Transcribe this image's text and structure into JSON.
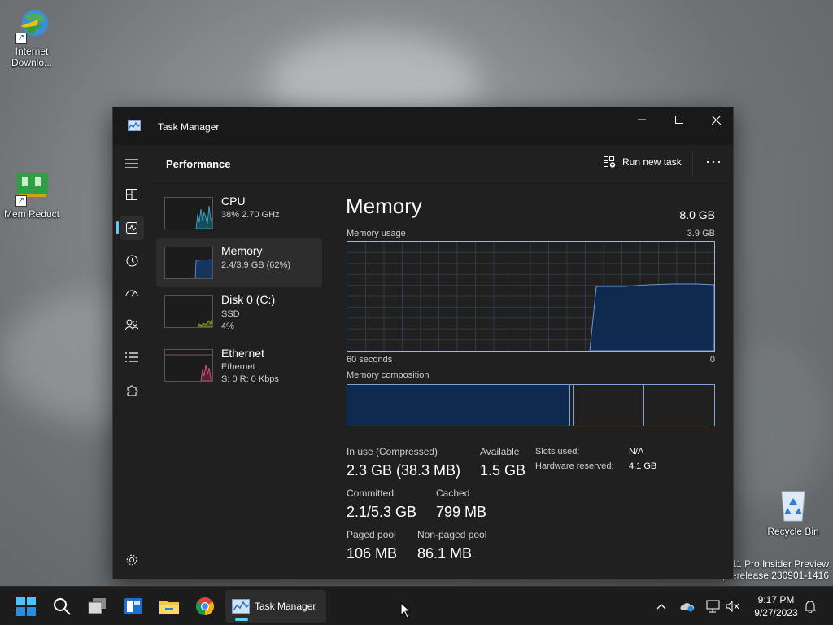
{
  "desktop": {
    "icons": [
      {
        "label_line1": "Internet",
        "label_line2": "Downlo..."
      },
      {
        "label_line1": "Mem Reduct",
        "label_line2": ""
      },
      {
        "label_line1": "Recycle Bin",
        "label_line2": ""
      }
    ],
    "watermark": {
      "line1": "11 Pro Insider Preview",
      "line2": "prerelease.230901-1416"
    }
  },
  "window": {
    "title": "Task Manager",
    "controls": {
      "minimize": "—",
      "maximize": "☐",
      "close": "✕"
    }
  },
  "toolbar": {
    "page_title": "Performance",
    "run_new_task": "Run new task",
    "more": "···"
  },
  "sidebar": {
    "items": [
      {
        "name": "CPU",
        "sub1": "38%  2.70 GHz",
        "sub2": ""
      },
      {
        "name": "Memory",
        "sub1": "2.4/3.9 GB (62%)",
        "sub2": ""
      },
      {
        "name": "Disk 0 (C:)",
        "sub1": "SSD",
        "sub2": "4%"
      },
      {
        "name": "Ethernet",
        "sub1": "Ethernet",
        "sub2": "S: 0  R: 0 Kbps"
      }
    ]
  },
  "memory": {
    "title": "Memory",
    "total": "8.0 GB",
    "usage_label": "Memory usage",
    "usage_max": "3.9 GB",
    "axis_left": "60 seconds",
    "axis_right": "0",
    "composition_label": "Memory composition",
    "stats": {
      "in_use_label": "In use (Compressed)",
      "in_use_value": "2.3 GB (38.3 MB)",
      "available_label": "Available",
      "available_value": "1.5 GB",
      "committed_label": "Committed",
      "committed_value": "2.1/5.3 GB",
      "cached_label": "Cached",
      "cached_value": "799 MB",
      "paged_label": "Paged pool",
      "paged_value": "106 MB",
      "nonpaged_label": "Non-paged pool",
      "nonpaged_value": "86.1 MB",
      "slots_label": "Slots used:",
      "slots_value": "N/A",
      "reserved_label": "Hardware reserved:",
      "reserved_value": "4.1 GB"
    }
  },
  "taskbar": {
    "active_app_label": "Task Manager",
    "time": "9:17 PM",
    "date": "9/27/2023"
  },
  "colors": {
    "accent": "#60cdff",
    "graph_line": "#7ea3d9",
    "graph_fill": "#102a4f",
    "window_bg": "#202020"
  }
}
